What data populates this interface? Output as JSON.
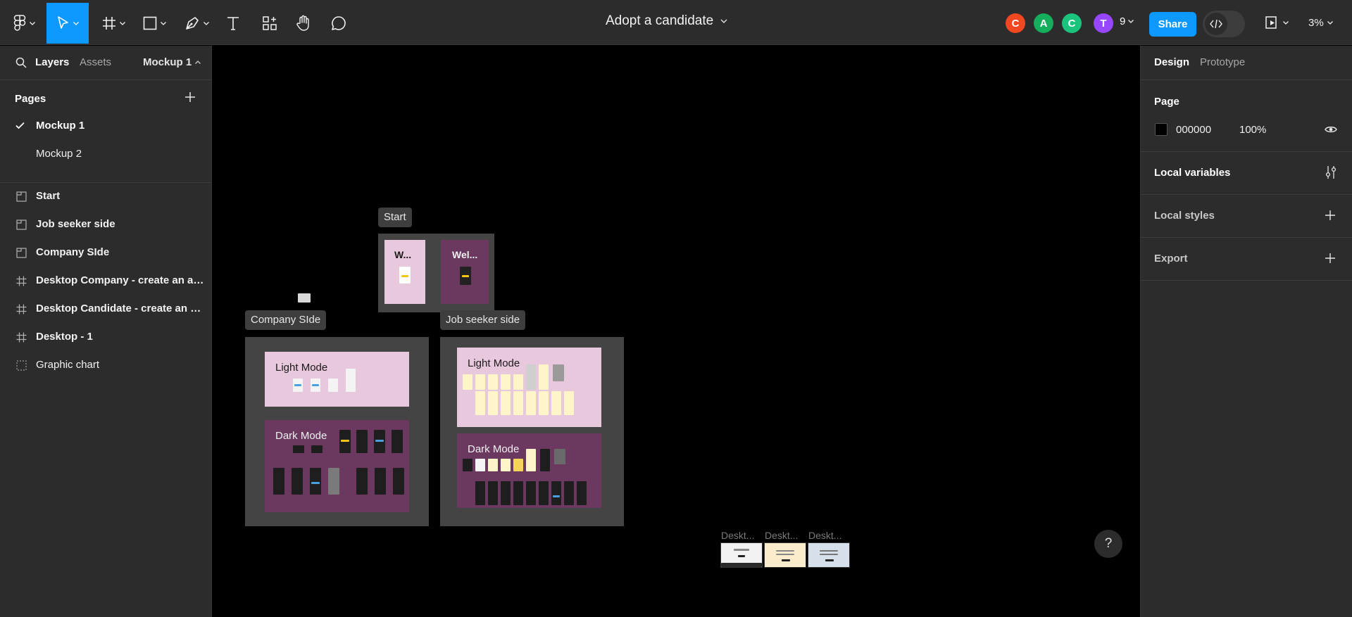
{
  "toolbar": {
    "document_title": "Adopt a candidate",
    "avatars": [
      {
        "letter": "C",
        "color": "#f24822"
      },
      {
        "letter": "A",
        "color": "#14ae5c"
      },
      {
        "letter": "C",
        "color": "#1bc47d"
      },
      {
        "letter": "T",
        "color": "#9747ff"
      }
    ],
    "collaborator_count": "9",
    "share_label": "Share",
    "zoom_label": "3%",
    "accent": "#0d99ff"
  },
  "left_panel": {
    "tabs": {
      "layers": "Layers",
      "assets": "Assets"
    },
    "current_page": "Mockup 1",
    "pages_heading": "Pages",
    "pages": [
      {
        "label": "Mockup 1",
        "selected": true
      },
      {
        "label": "Mockup 2",
        "selected": false
      }
    ],
    "layers": [
      {
        "label": "Start",
        "icon": "section-icon"
      },
      {
        "label": "Job seeker side",
        "icon": "section-icon"
      },
      {
        "label": "Company SIde",
        "icon": "section-icon"
      },
      {
        "label": "Desktop Company - create an acc...",
        "icon": "frame-icon"
      },
      {
        "label": "Desktop Candidate - create an ac...",
        "icon": "frame-icon"
      },
      {
        "label": "Desktop - 1",
        "icon": "frame-icon"
      },
      {
        "label": "Graphic chart",
        "icon": "dashed-frame-icon"
      }
    ]
  },
  "canvas": {
    "start_label": "Start",
    "start_frames": [
      "W...",
      "Wel..."
    ],
    "company_label": "Company SIde",
    "job_label": "Job seeker side",
    "light_mode": "Light Mode",
    "dark_mode": "Dark Mode",
    "desktop_labels": [
      "Deskt...",
      "Deskt...",
      "Deskt..."
    ],
    "help_label": "?"
  },
  "right_panel": {
    "tabs": {
      "design": "Design",
      "prototype": "Prototype"
    },
    "page_heading": "Page",
    "page_color_hex": "000000",
    "page_opacity": "100%",
    "local_variables": "Local variables",
    "local_styles": "Local styles",
    "export": "Export"
  }
}
